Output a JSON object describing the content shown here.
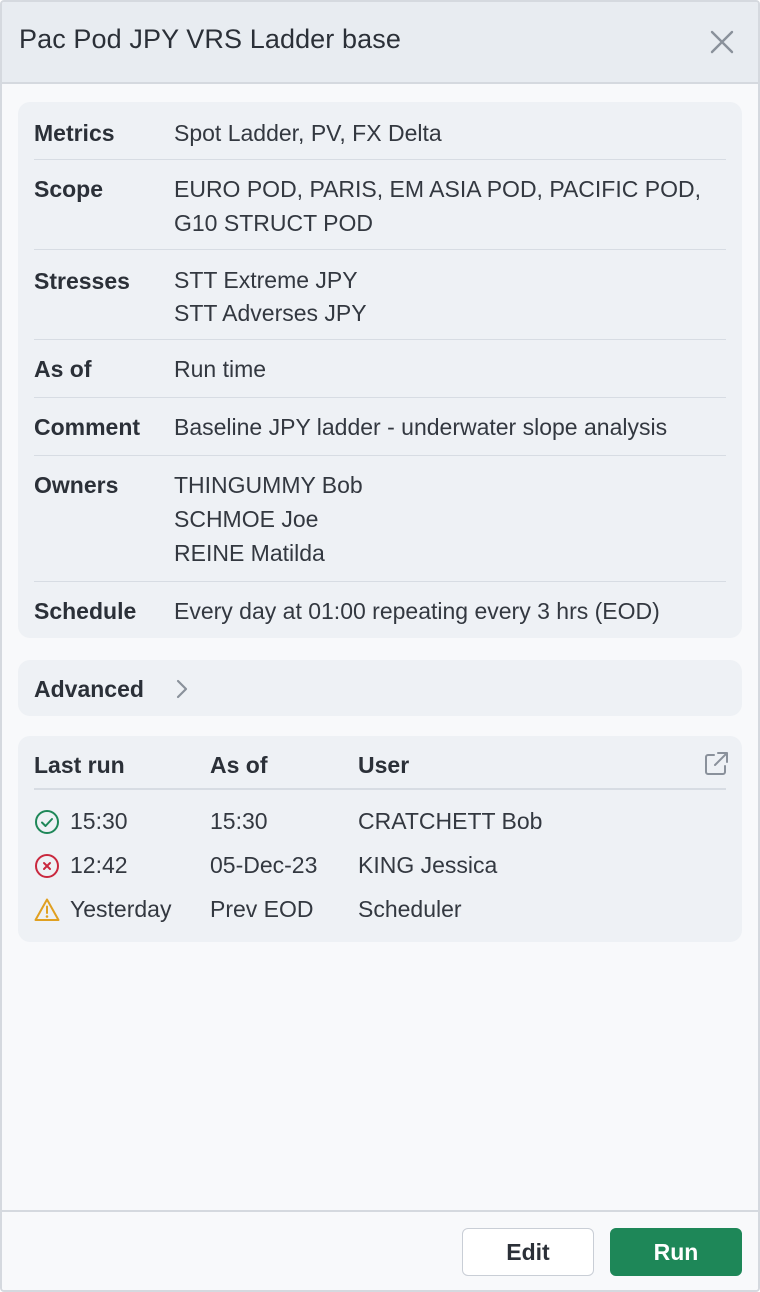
{
  "dialog": {
    "title": "Pac Pod JPY VRS Ladder base"
  },
  "details": {
    "metrics": {
      "label": "Metrics",
      "value": "Spot Ladder, PV, FX Delta"
    },
    "scope": {
      "label": "Scope",
      "lines": [
        "EURO POD, PARIS, EM ASIA POD, PACIFIC POD,",
        "G10 STRUCT POD"
      ]
    },
    "stresses": {
      "label": "Stresses",
      "lines": [
        "STT Extreme JPY",
        "STT Adverses JPY"
      ]
    },
    "as_of": {
      "label": "As of",
      "value": "Run time"
    },
    "comment": {
      "label": "Comment",
      "value": "Baseline JPY ladder - underwater slope analysis"
    },
    "owners": {
      "label": "Owners",
      "lines": [
        "THINGUMMY Bob",
        "SCHMOE Joe",
        "REINE Matilda"
      ]
    },
    "schedule": {
      "label": "Schedule",
      "value": "Every day at 01:00 repeating every 3 hrs (EOD)"
    }
  },
  "advanced": {
    "label": "Advanced"
  },
  "runs": {
    "headers": {
      "last_run": "Last run",
      "as_of": "As of",
      "user": "User"
    },
    "rows": [
      {
        "status": "success",
        "last_run": "15:30",
        "as_of": "15:30",
        "user": "CRATCHETT Bob"
      },
      {
        "status": "failed",
        "last_run": "12:42",
        "as_of": "05-Dec-23",
        "user": "KING Jessica"
      },
      {
        "status": "warning",
        "last_run": "Yesterday",
        "as_of": "Prev EOD",
        "user": "Scheduler"
      }
    ]
  },
  "footer": {
    "edit_label": "Edit",
    "run_label": "Run"
  },
  "colors": {
    "success": "#1e8758",
    "failed": "#c9283e",
    "warning": "#e0a021",
    "primary_button": "#1e8758"
  }
}
